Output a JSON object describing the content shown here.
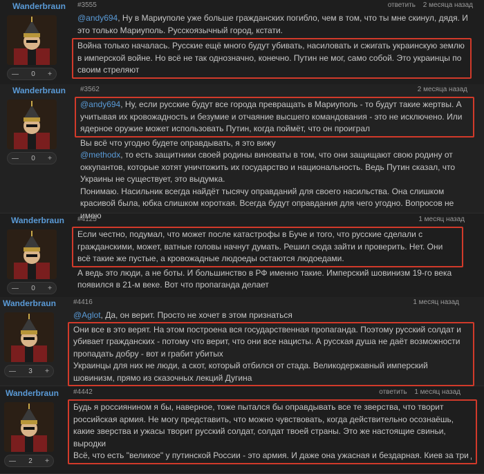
{
  "posts": [
    {
      "username": "Wanderbraun",
      "votes": "0",
      "id": "#3555",
      "reply": "ответить",
      "time": "2 месяца назад",
      "mention": "@andy694",
      "intro": ", Ну в Мариуполе уже больше гражданских погибло, чем в том, что ты мне скинул, дядя. И это только Мариуполь. Русскоязычный город, кстати.",
      "highlight": "Война только началась. Русские ещё много будут убивать, насиловать и сжигать украинскую землю в имперской войне. Но всё не так однозначно, конечно. Путин не мог, само собой. Это украинцы по своим стреляют"
    },
    {
      "username": "Wanderbraun",
      "votes": "0",
      "id": "#3562",
      "time": "2 месяца назад",
      "mention": "@andy694",
      "highlight": ", Ну, если русские будут все города превращать в Мариуполь - то будут такие жертвы. А учитывая их кровожадность и безумие и отчаяние высшего командования - это не исключено. Или ядерное оружие может использовать Путин, когда поймёт, что он проиграл",
      "line2": "Вы всё что угодно будете оправдывать, я это вижу",
      "mention2": "@methodx",
      "line3": ", то есть защитники своей родины виноваты в том, что они защищают свою родину от оккупантов, которые хотят уничтожить их государство и национальность. Ведь Путин сказал, что Украины не существует, это выдумка.",
      "line4": "Понимаю. Насильник всегда найдёт тысячу оправданий для своего насильства. Она слишком красивой была, юбка слишком короткая. Всегда будут оправдания для чего угодно. Вопросов не имею"
    },
    {
      "username": "Wanderbraun",
      "votes": "0",
      "id": "#4125",
      "time": "1 месяц назад",
      "highlight": "Если честно, подумал, что может после катастрофы в Буче и того, что русские сделали с гражданскими, может, ватные головы начнут думать. Решил сюда зайти и проверить. Нет. Они всё такие же пустые, а кровожадные людоеды остаются людоедами.",
      "after": "А ведь это люди, а не боты. И большинство в РФ именно такие. Имперский шовинизм 19-го века появился в 21-м веке. Вот что пропаганда делает"
    },
    {
      "username": "Wanderbraun",
      "votes": "3",
      "id": "#4416",
      "time": "1 месяц назад",
      "mention": "@Aglot",
      "intro": ", Да, он верит. Просто не хочет в этом признаться",
      "highlight1": "Они все в это верят. На этом построена вся государственная пропаганда. Поэтому русский солдат и убивает гражданских - потому что верит, что они все нацисты. А русская душа не даёт возможности пропадать добру - вот и грабит убитых",
      "highlight2": "Украинцы для них не люди, а скот, который отбился от стада. Великодержавный имперский шовинизм, прямо из сказочных лекций Дугина"
    },
    {
      "username": "Wanderbraun",
      "votes": "2",
      "id": "#4442",
      "reply": "ответить",
      "time": "1 месяц назад",
      "highlight": "Будь я россиянином я бы, наверное, тоже пытался бы оправдывать все те зверства, что творит российская армия. Не могу представить, что можно чувствовать, когда действительно осознаёшь, какие зверства и ужасы творит русский солдат, солдат твоей страны. Это же настоящие свиньи, выродки",
      "tail": "Всё, что есть \"великое\" у путинской России - это армия. И даже она ужасная и бездарная. Киев за три дня, господи…"
    }
  ],
  "ui": {
    "minus": "—",
    "plus": "+"
  },
  "colors": {
    "background": "#1e1e1e",
    "username": "#5a9ad6",
    "mention": "#5a9ad6",
    "highlight_border": "#d23a2a"
  }
}
